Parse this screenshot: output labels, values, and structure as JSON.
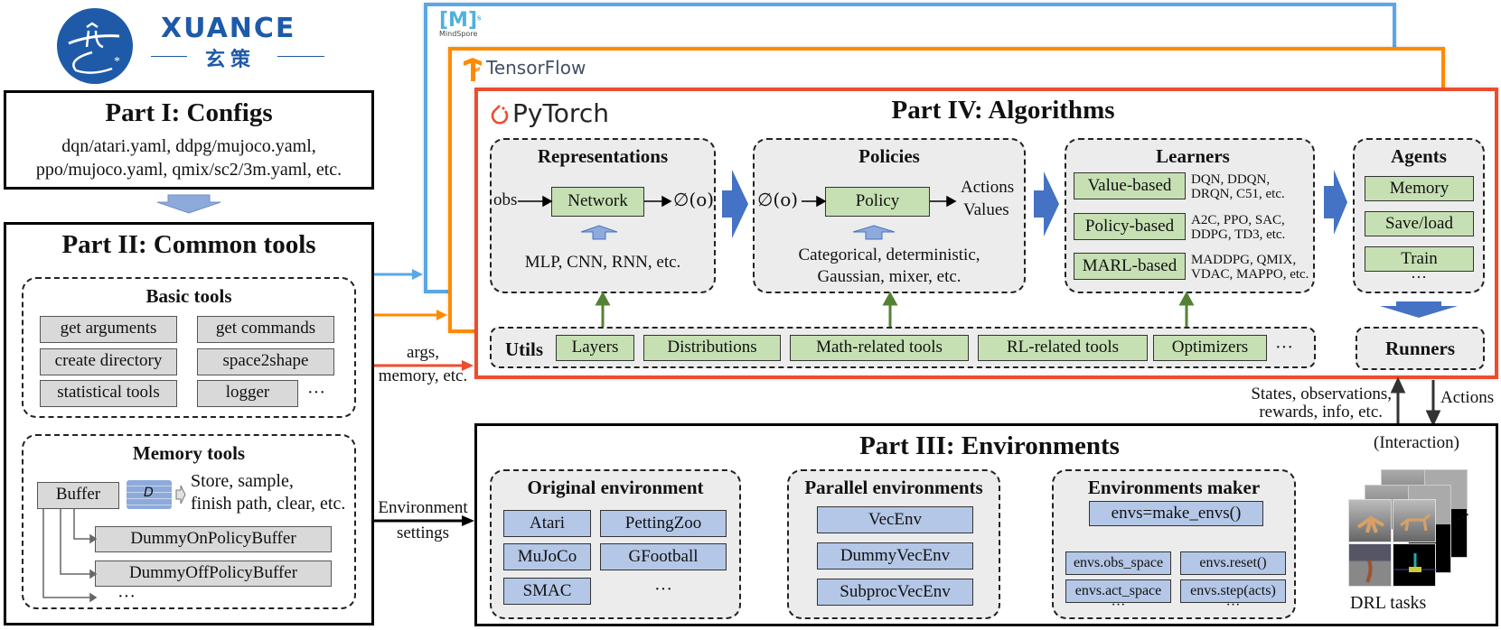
{
  "logo": {
    "brand": "XUANCE",
    "chinese": "玄策"
  },
  "frameworks": {
    "mindspore": "MindSpore",
    "mindspore_mark": "[M]",
    "mindspore_sup": "s",
    "tensorflow": "TensorFlow",
    "pytorch": "PyTorch"
  },
  "part1": {
    "title": "Part I: Configs",
    "line1": "dqn/atari.yaml, ddpg/mujoco.yaml,",
    "line2": "ppo/mujoco.yaml, qmix/sc2/3m.yaml, etc."
  },
  "part2": {
    "title": "Part II: Common tools",
    "basic": {
      "title": "Basic tools",
      "items": [
        "get arguments",
        "get commands",
        "create directory",
        "space2shape",
        "statistical tools",
        "logger"
      ],
      "ellipsis": "···"
    },
    "memory": {
      "title": "Memory tools",
      "buffer": "Buffer",
      "db_label": "D",
      "ops_line1": "Store, sample,",
      "ops_line2": "finish path, clear, etc.",
      "items": [
        "DummyOnPolicyBuffer",
        "DummyOffPolicyBuffer"
      ],
      "ellipsis": "···"
    }
  },
  "connectors": {
    "args_line1": "args,",
    "args_line2": "memory, etc.",
    "env_line1": "Environment",
    "env_line2": "settings",
    "states_line1": "States, observations,",
    "states_line2": "rewards, info, etc.",
    "actions": "Actions",
    "interaction": "(Interaction)"
  },
  "part4": {
    "title": "Part IV: Algorithms",
    "representations": {
      "title": "Representations",
      "input": "obs",
      "block": "Network",
      "output": "∅(o)",
      "note": "MLP, CNN, RNN, etc."
    },
    "policies": {
      "title": "Policies",
      "input": "∅(o)",
      "block": "Policy",
      "out1": "Actions",
      "out2": "Values",
      "note1": "Categorical, deterministic,",
      "note2": "Gaussian, mixer, etc."
    },
    "learners": {
      "title": "Learners",
      "items": [
        {
          "label": "Value-based",
          "desc1": "DQN, DDQN,",
          "desc2": "DRQN, C51, etc."
        },
        {
          "label": "Policy-based",
          "desc1": "A2C, PPO, SAC,",
          "desc2": "DDPG, TD3, etc."
        },
        {
          "label": "MARL-based",
          "desc1": "MADDPG, QMIX,",
          "desc2": "VDAC, MAPPO, etc."
        }
      ]
    },
    "agents": {
      "title": "Agents",
      "items": [
        "Memory",
        "Save/load",
        "Train"
      ],
      "ellipsis": "···"
    },
    "utils": {
      "title": "Utils",
      "items": [
        "Layers",
        "Distributions",
        "Math-related tools",
        "RL-related tools",
        "Optimizers"
      ],
      "ellipsis": "···"
    },
    "runners": "Runners"
  },
  "part3": {
    "title": "Part III: Environments",
    "original": {
      "title": "Original environment",
      "items": [
        "Atari",
        "PettingZoo",
        "MuJoCo",
        "GFootball",
        "SMAC"
      ],
      "ellipsis": "···"
    },
    "parallel": {
      "title": "Parallel environments",
      "items": [
        "VecEnv",
        "DummyVecEnv",
        "SubprocVecEnv"
      ]
    },
    "maker": {
      "title": "Environments maker",
      "call": "envs=make_envs()",
      "items": [
        "envs.obs_space",
        "envs.reset()",
        "envs.act_space",
        "envs.step(acts)"
      ],
      "ellipsis": "···"
    },
    "tasks_label": "DRL tasks"
  },
  "colors": {
    "mindspore": "#5aa7e8",
    "tensorflow": "#ff8a00",
    "pytorch": "#ee4c2c",
    "green_box": "#c6e0b4",
    "blue_box": "#b4c7e7",
    "arrow_blue": "#4472c4",
    "arrow_green": "#548235"
  }
}
